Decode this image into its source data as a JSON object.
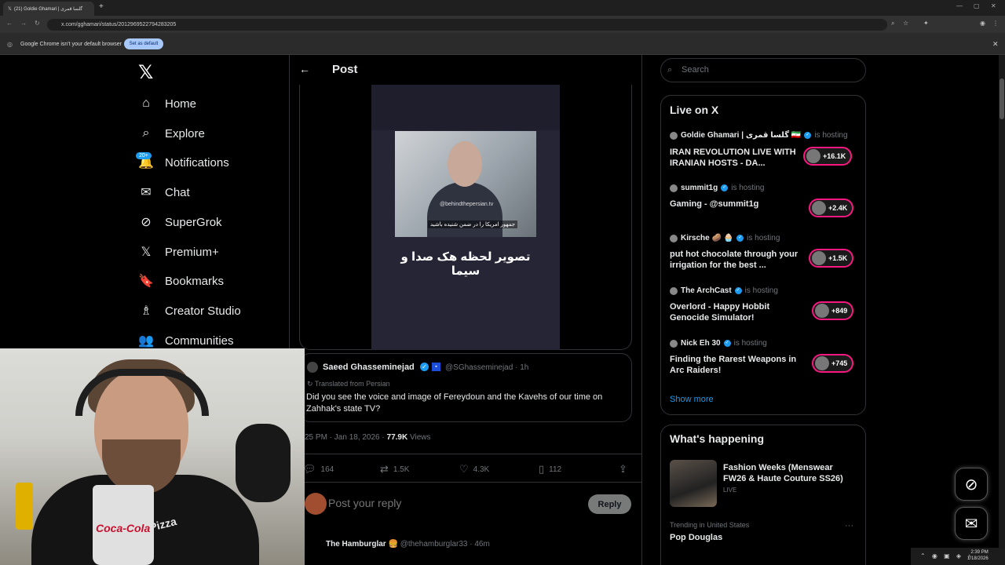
{
  "browser": {
    "tab_title": "(21) Goldie Ghamari | گلسا قمری",
    "url": "x.com/gghamari/status/2012969522794283205",
    "infobar_text": "Google Chrome isn't your default browser",
    "set_default_label": "Set as default"
  },
  "sidebar": {
    "logo": "𝕏",
    "notifications_badge": "20+",
    "items": [
      {
        "label": "Home",
        "icon": "⌂"
      },
      {
        "label": "Explore",
        "icon": "⌕"
      },
      {
        "label": "Notifications",
        "icon": "🔔"
      },
      {
        "label": "Chat",
        "icon": "✉"
      },
      {
        "label": "SuperGrok",
        "icon": "⊘"
      },
      {
        "label": "Premium+",
        "icon": "𝕏"
      },
      {
        "label": "Bookmarks",
        "icon": "🔖"
      },
      {
        "label": "Creator Studio",
        "icon": "♗"
      },
      {
        "label": "Communities",
        "icon": "👥"
      }
    ]
  },
  "post": {
    "header_title": "Post",
    "back_icon": "←",
    "video_watermark": "@behindthepersian.tv",
    "video_subtitle": "جمهور امریکا را در ضمن شنیده باشید",
    "video_caption": "تصویر لحظه هک صدا و سیما",
    "quoted": {
      "name": "Saeed Ghasseminejad",
      "handle": "@SGhasseminejad · 1h",
      "translated_from": "Translated from Persian",
      "text": "Did you see the voice and image of Fereydoun and the Kavehs of our time on Zahhak's state TV?"
    },
    "meta_time": "25 PM · Jan 18, 2026 · ",
    "meta_views_count": "77.9K",
    "meta_views_label": " Views",
    "stats": {
      "replies": "164",
      "reposts": "1.5K",
      "likes": "4.3K",
      "bookmarks": "112"
    },
    "reply_placeholder": "Post your reply",
    "reply_button": "Reply",
    "next_name": "The Hamburglar 🍔",
    "next_handle": "@thehamburglar33 · 46m"
  },
  "right": {
    "search_placeholder": "Search",
    "live_title": "Live on X",
    "live": [
      {
        "host": "Goldie Ghamari | گلسا قمری 🇮🇷",
        "status": "is hosting",
        "title": "IRAN REVOLUTION LIVE WITH IRANIAN HOSTS - DA...",
        "count": "+16.1K"
      },
      {
        "host": "summit1g",
        "status": "is hosting",
        "title": "Gaming - @summit1g",
        "count": "+2.4K"
      },
      {
        "host": "Kirsche 🥔 🧁",
        "status": "is hosting",
        "title": "put hot chocolate through your irrigation for the best ...",
        "count": "+1.5K"
      },
      {
        "host": "The ArchCast",
        "status": "is hosting",
        "title": "Overlord - Happy Hobbit Genocide Simulator!",
        "count": "+849"
      },
      {
        "host": "Nick Eh 30",
        "status": "is hosting",
        "title": "Finding the Rarest Weapons in Arc Raiders!",
        "count": "+745"
      }
    ],
    "show_more": "Show more",
    "happening_title": "What's happening",
    "happening_item_title": "Fashion Weeks (Menswear FW26 & Haute Couture SS26)",
    "happening_item_status": "LIVE",
    "trend_location": "Trending in United States",
    "trend_name": "Pop Douglas"
  },
  "webcam": {
    "cup_logo": "Coca-Cola",
    "shirt_logo": "Pizza"
  },
  "taskbar": {
    "time": "2:39 PM",
    "date": "1/18/2026"
  },
  "colors": {
    "accent": "#1d9bf0",
    "live_ring": "#f91880",
    "background": "#000000"
  }
}
